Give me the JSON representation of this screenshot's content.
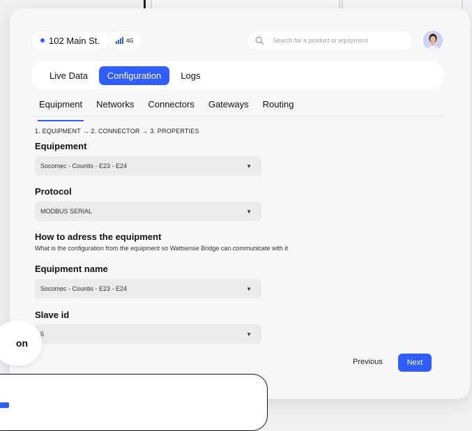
{
  "location": {
    "label": "102 Main St."
  },
  "network": {
    "label": "4G"
  },
  "search": {
    "placeholder": "Search for a product or equipment"
  },
  "main_tabs": [
    {
      "label": "Live Data",
      "active": false
    },
    {
      "label": "Configuration",
      "active": true
    },
    {
      "label": "Logs",
      "active": false
    }
  ],
  "sub_tabs": [
    {
      "label": "Equipment",
      "active": true
    },
    {
      "label": "Networks",
      "active": false
    },
    {
      "label": "Connectors",
      "active": false
    },
    {
      "label": "Gateways",
      "active": false
    },
    {
      "label": "Routing",
      "active": false
    }
  ],
  "steps": "1. EQUIPMENT → 2. CONNECTOR → 3. PROPERTIES",
  "form": {
    "equipment_label": "Equipement",
    "equipment_value": "Socomec - Countis - E23 - E24",
    "protocol_label": "Protocol",
    "protocol_value": "MODBUS  SERIAL",
    "how_title": "How to adress the equipment",
    "how_desc": "What is the configuration from the equipment so Wattsense Bridge can communicate with it",
    "name_label": "Equipment name",
    "name_value": "Socomec - Countis - E23 - E24",
    "slave_label": "Slave id",
    "slave_value": "5"
  },
  "buttons": {
    "previous": "Previous",
    "next": "Next"
  },
  "floating": {
    "chip_text": "on"
  },
  "colors": {
    "accent": "#2f5dff",
    "card_bg": "#f7f7f8",
    "field_bg": "#ebebed"
  },
  "icons": {
    "search": "search-icon",
    "signal": "signal-icon",
    "dropdown": "caret-down-icon"
  }
}
